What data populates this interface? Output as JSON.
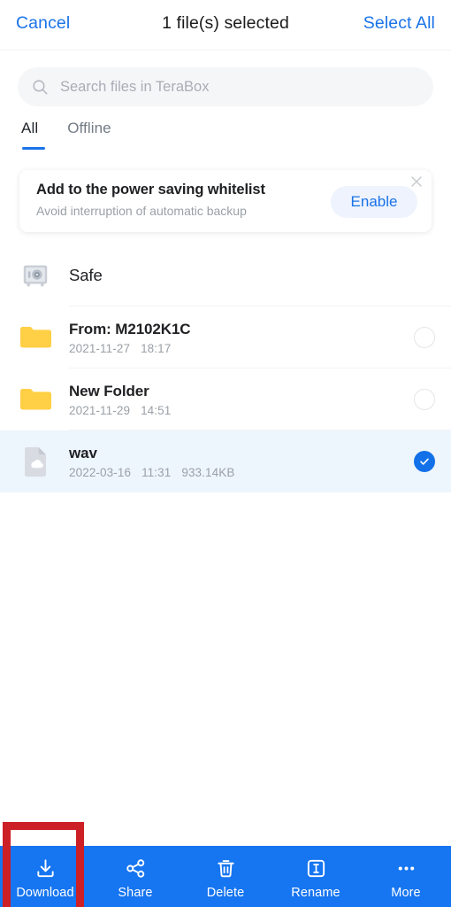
{
  "header": {
    "cancel_label": "Cancel",
    "title": "1 file(s) selected",
    "select_all_label": "Select All"
  },
  "search": {
    "placeholder": "Search files in TeraBox",
    "value": "",
    "icon": "search-icon"
  },
  "tabs": [
    {
      "label": "All",
      "active": true
    },
    {
      "label": "Offline",
      "active": false
    }
  ],
  "banner": {
    "title": "Add to the power saving whitelist",
    "subtitle": "Avoid interruption of automatic backup",
    "cta_label": "Enable",
    "close_icon": "close-icon"
  },
  "files": [
    {
      "name": "Safe",
      "icon": "safe-vault-icon",
      "date": "",
      "time": "",
      "size": "",
      "selectable": false,
      "selected": false
    },
    {
      "name": "From: M2102K1C",
      "icon": "folder-icon",
      "date": "2021-11-27",
      "time": "18:17",
      "size": "",
      "selectable": true,
      "selected": false
    },
    {
      "name": "New Folder",
      "icon": "folder-icon",
      "date": "2021-11-29",
      "time": "14:51",
      "size": "",
      "selectable": true,
      "selected": false
    },
    {
      "name": "wav",
      "icon": "cloud-file-icon",
      "date": "2022-03-16",
      "time": "11:31",
      "size": "933.14KB",
      "selectable": true,
      "selected": true
    }
  ],
  "toolbar": [
    {
      "label": "Download",
      "icon": "download-icon",
      "highlighted": true
    },
    {
      "label": "Share",
      "icon": "share-icon",
      "highlighted": false
    },
    {
      "label": "Delete",
      "icon": "trash-icon",
      "highlighted": false
    },
    {
      "label": "Rename",
      "icon": "rename-icon",
      "highlighted": false
    },
    {
      "label": "More",
      "icon": "more-dots-icon",
      "highlighted": false
    }
  ],
  "colors": {
    "accent_blue": "#1a73e8",
    "toolbar_blue": "#1675f0",
    "selected_row": "#eef6fd",
    "annotation_red": "#cc1f26",
    "folder_yellow": "#ffcf45"
  }
}
